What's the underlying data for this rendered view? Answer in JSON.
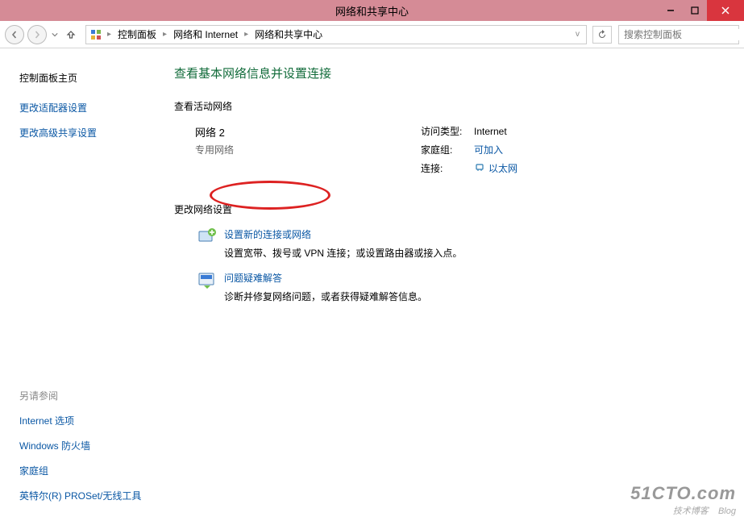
{
  "window": {
    "title": "网络和共享中心"
  },
  "toolbar": {
    "breadcrumbs": [
      "控制面板",
      "网络和 Internet",
      "网络和共享中心"
    ],
    "search_placeholder": "搜索控制面板"
  },
  "sidebar": {
    "home": "控制面板主页",
    "links": [
      "更改适配器设置",
      "更改高级共享设置"
    ],
    "see_also_title": "另请参阅",
    "see_also": [
      "Internet 选项",
      "Windows 防火墙",
      "家庭组",
      "英特尔(R) PROSet/无线工具"
    ]
  },
  "main": {
    "heading": "查看基本网络信息并设置连接",
    "active_section": "查看活动网络",
    "network": {
      "name": "网络  2",
      "type": "专用网络",
      "access_label": "访问类型:",
      "access_value": "Internet",
      "homegroup_label": "家庭组:",
      "homegroup_value": "可加入",
      "conn_label": "连接:",
      "conn_value": "以太网"
    },
    "change_section": "更改网络设置",
    "items": [
      {
        "link": "设置新的连接或网络",
        "desc": "设置宽带、拨号或 VPN 连接；或设置路由器或接入点。"
      },
      {
        "link": "问题疑难解答",
        "desc": "诊断并修复网络问题，或者获得疑难解答信息。"
      }
    ]
  },
  "watermark": {
    "line1": "51CTO.com",
    "line2": "技术博客",
    "line3": "Blog"
  }
}
